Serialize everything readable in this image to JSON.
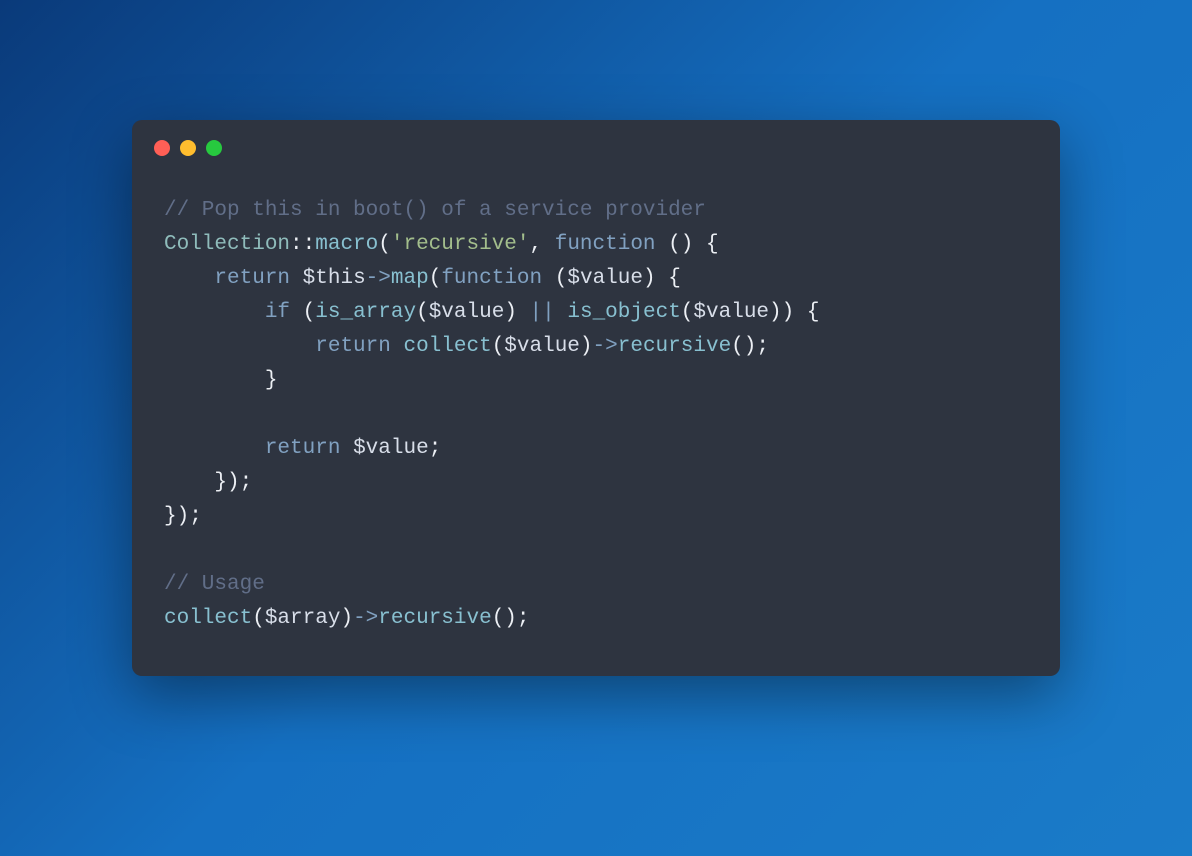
{
  "window": {
    "traffic_lights": [
      "red",
      "yellow",
      "green"
    ]
  },
  "code": {
    "lines": [
      {
        "type": "comment",
        "text": "// Pop this in boot() of a service provider"
      },
      {
        "type": "code",
        "tokens": [
          {
            "class": "classname",
            "text": "Collection"
          },
          {
            "class": "punct",
            "text": "::"
          },
          {
            "class": "method",
            "text": "macro"
          },
          {
            "class": "punct",
            "text": "("
          },
          {
            "class": "string",
            "text": "'recursive'"
          },
          {
            "class": "punct",
            "text": ", "
          },
          {
            "class": "keyword",
            "text": "function"
          },
          {
            "class": "punct",
            "text": " () {"
          }
        ]
      },
      {
        "type": "code",
        "indent": 1,
        "tokens": [
          {
            "class": "keyword",
            "text": "return"
          },
          {
            "class": "punct",
            "text": " "
          },
          {
            "class": "variable",
            "text": "$this"
          },
          {
            "class": "arrow",
            "text": "->"
          },
          {
            "class": "method",
            "text": "map"
          },
          {
            "class": "punct",
            "text": "("
          },
          {
            "class": "keyword",
            "text": "function"
          },
          {
            "class": "punct",
            "text": " ("
          },
          {
            "class": "variable",
            "text": "$value"
          },
          {
            "class": "punct",
            "text": ") {"
          }
        ]
      },
      {
        "type": "code",
        "indent": 2,
        "tokens": [
          {
            "class": "keyword",
            "text": "if"
          },
          {
            "class": "punct",
            "text": " ("
          },
          {
            "class": "method",
            "text": "is_array"
          },
          {
            "class": "punct",
            "text": "("
          },
          {
            "class": "variable",
            "text": "$value"
          },
          {
            "class": "punct",
            "text": ") "
          },
          {
            "class": "arrow",
            "text": "||"
          },
          {
            "class": "punct",
            "text": " "
          },
          {
            "class": "method",
            "text": "is_object"
          },
          {
            "class": "punct",
            "text": "("
          },
          {
            "class": "variable",
            "text": "$value"
          },
          {
            "class": "punct",
            "text": ")) {"
          }
        ]
      },
      {
        "type": "code",
        "indent": 3,
        "tokens": [
          {
            "class": "keyword",
            "text": "return"
          },
          {
            "class": "punct",
            "text": " "
          },
          {
            "class": "method",
            "text": "collect"
          },
          {
            "class": "punct",
            "text": "("
          },
          {
            "class": "variable",
            "text": "$value"
          },
          {
            "class": "punct",
            "text": ")"
          },
          {
            "class": "arrow",
            "text": "->"
          },
          {
            "class": "method",
            "text": "recursive"
          },
          {
            "class": "punct",
            "text": "();"
          }
        ]
      },
      {
        "type": "code",
        "indent": 2,
        "tokens": [
          {
            "class": "punct",
            "text": "}"
          }
        ]
      },
      {
        "type": "blank"
      },
      {
        "type": "code",
        "indent": 2,
        "tokens": [
          {
            "class": "keyword",
            "text": "return"
          },
          {
            "class": "punct",
            "text": " "
          },
          {
            "class": "variable",
            "text": "$value"
          },
          {
            "class": "punct",
            "text": ";"
          }
        ]
      },
      {
        "type": "code",
        "indent": 1,
        "tokens": [
          {
            "class": "punct",
            "text": "});"
          }
        ]
      },
      {
        "type": "code",
        "indent": 0,
        "tokens": [
          {
            "class": "punct",
            "text": "});"
          }
        ]
      },
      {
        "type": "blank"
      },
      {
        "type": "comment",
        "text": "// Usage"
      },
      {
        "type": "code",
        "indent": 0,
        "tokens": [
          {
            "class": "method",
            "text": "collect"
          },
          {
            "class": "punct",
            "text": "("
          },
          {
            "class": "variable",
            "text": "$array"
          },
          {
            "class": "punct",
            "text": ")"
          },
          {
            "class": "arrow",
            "text": "->"
          },
          {
            "class": "method",
            "text": "recursive"
          },
          {
            "class": "punct",
            "text": "();"
          }
        ]
      }
    ]
  }
}
